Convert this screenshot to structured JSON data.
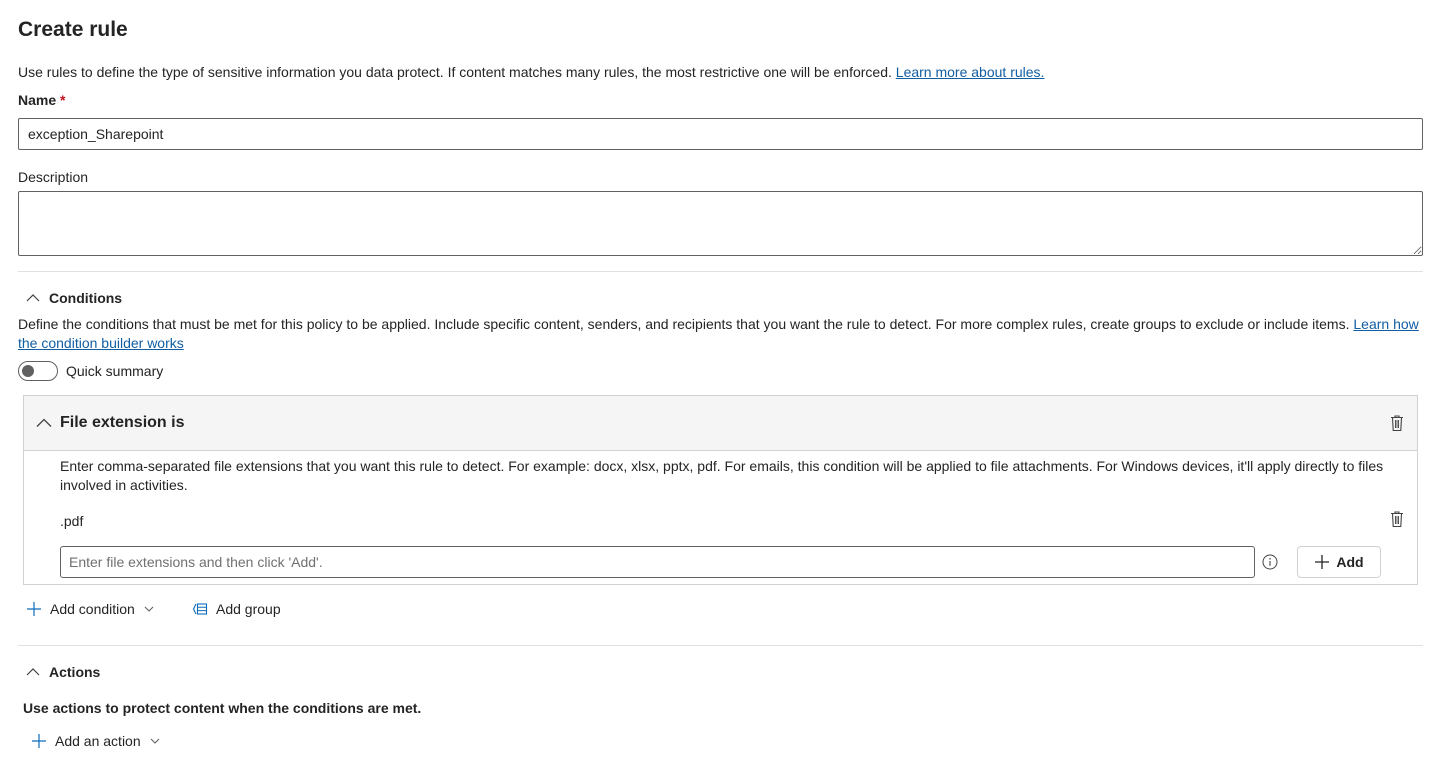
{
  "page": {
    "title": "Create rule",
    "intro": "Use rules to define the type of sensitive information you data protect. If content matches many rules, the most restrictive one will be enforced.",
    "intro_link": "Learn more about rules."
  },
  "name_field": {
    "label": "Name",
    "required_mark": "*",
    "value": "exception_Sharepoint"
  },
  "description_field": {
    "label": "Description",
    "value": ""
  },
  "conditions": {
    "heading": "Conditions",
    "description": "Define the conditions that must be met for this policy to be applied. Include specific content, senders, and recipients that you want the rule to detect. For more complex rules, create groups to exclude or include items.",
    "link": "Learn how the condition builder works",
    "quick_summary_label": "Quick summary",
    "quick_summary_on": false,
    "card": {
      "title": "File extension is",
      "description": "Enter comma-separated file extensions that you want this rule to detect. For example: docx, xlsx, pptx, pdf. For emails, this condition will be applied to file attachments. For Windows devices, it'll apply directly to files involved in activities.",
      "extensions": [
        ".pdf"
      ],
      "input_placeholder": "Enter file extensions and then click 'Add'.",
      "add_button": "Add"
    },
    "add_condition": "Add condition",
    "add_group": "Add group"
  },
  "actions": {
    "heading": "Actions",
    "description": "Use actions to protect content when the conditions are met.",
    "add_action": "Add an action"
  },
  "colors": {
    "link": "#115ea3",
    "required": "#c50f1f",
    "card_header_bg": "#f5f5f5",
    "accent": "#0f6cbd"
  },
  "icons": {
    "collapse": "chevron-up-icon",
    "delete": "trash-icon",
    "info": "info-icon",
    "add": "plus-icon",
    "group": "group-icon",
    "dropdown": "chevron-down-icon"
  }
}
